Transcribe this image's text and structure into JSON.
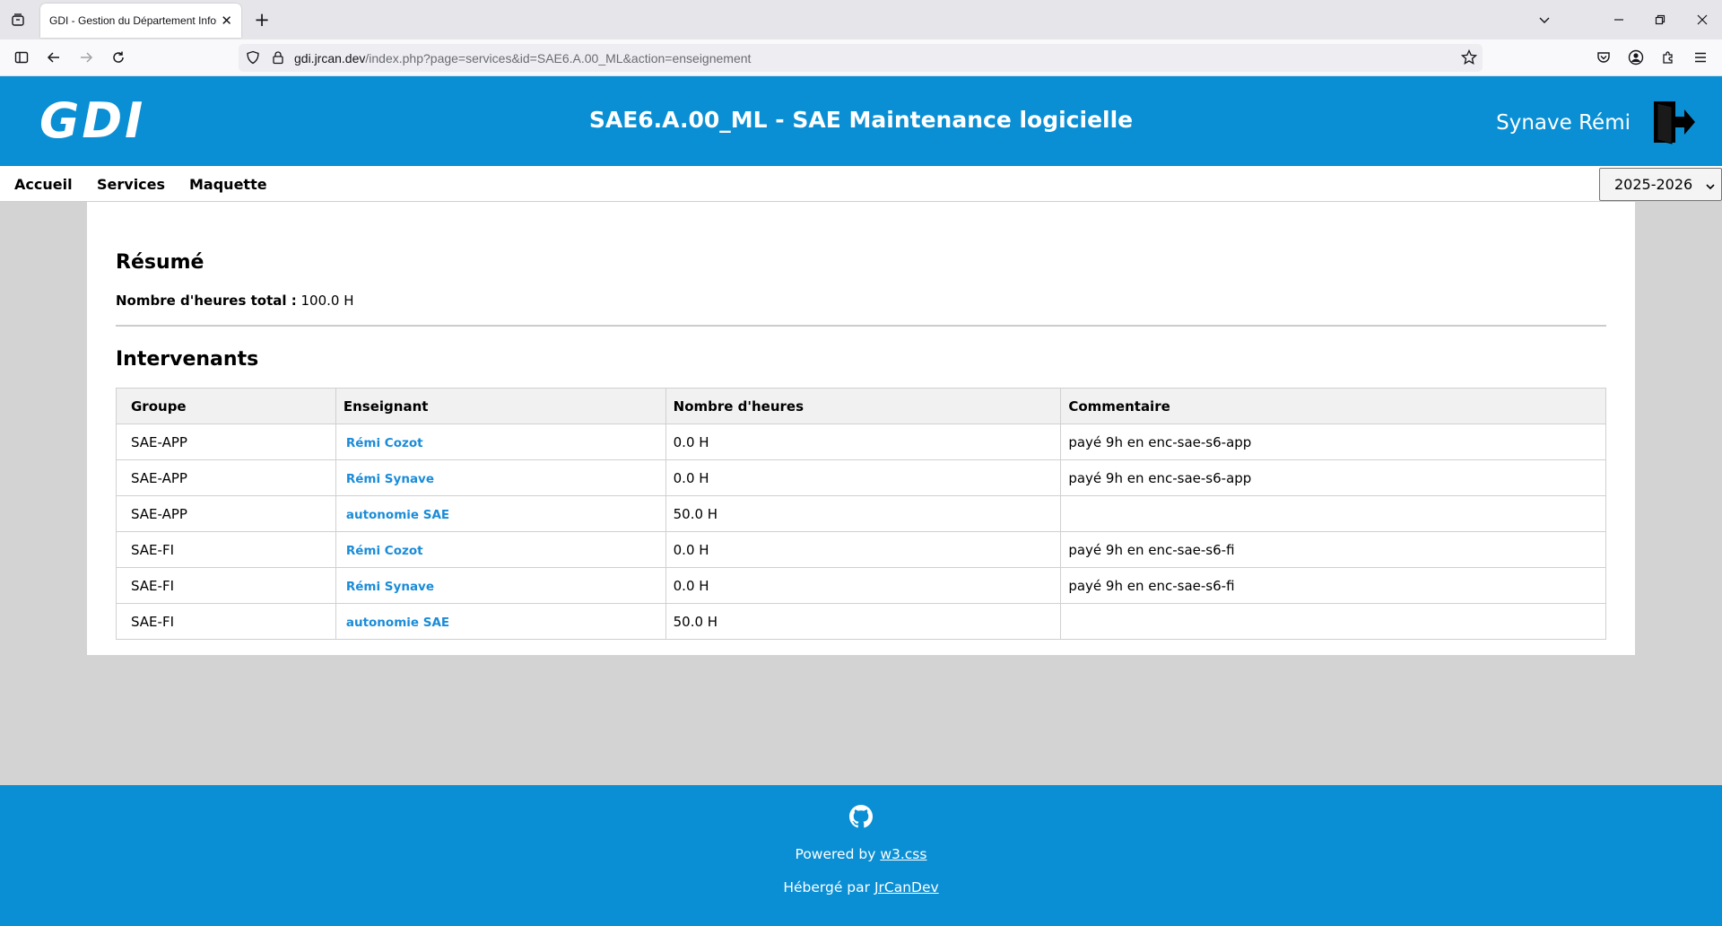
{
  "browser": {
    "tab_title": "GDI - Gestion du Département Informatique",
    "url_host": "gdi.jrcan.dev",
    "url_path": "/index.php?page=services&id=SAE6.A.00_ML&action=enseignement"
  },
  "header": {
    "logo": "GDI",
    "title": "SAE6.A.00_ML - SAE Maintenance logicielle",
    "user": "Synave Rémi"
  },
  "menu": {
    "items": [
      "Accueil",
      "Services",
      "Maquette"
    ],
    "year_selected": "2025-2026"
  },
  "summary": {
    "heading": "Résumé",
    "total_label": "Nombre d'heures total :",
    "total_value": "100.0 H"
  },
  "intervenants": {
    "heading": "Intervenants",
    "columns": [
      "Groupe",
      "Enseignant",
      "Nombre d'heures",
      "Commentaire"
    ],
    "rows": [
      {
        "groupe": "SAE-APP",
        "enseignant": "Rémi Cozot",
        "heures": "0.0 H",
        "commentaire": "payé 9h en enc-sae-s6-app"
      },
      {
        "groupe": "SAE-APP",
        "enseignant": "Rémi Synave",
        "heures": "0.0 H",
        "commentaire": "payé 9h en enc-sae-s6-app"
      },
      {
        "groupe": "SAE-APP",
        "enseignant": "autonomie SAE",
        "heures": "50.0 H",
        "commentaire": ""
      },
      {
        "groupe": "SAE-FI",
        "enseignant": "Rémi Cozot",
        "heures": "0.0 H",
        "commentaire": "payé 9h en enc-sae-s6-fi"
      },
      {
        "groupe": "SAE-FI",
        "enseignant": "Rémi Synave",
        "heures": "0.0 H",
        "commentaire": "payé 9h en enc-sae-s6-fi"
      },
      {
        "groupe": "SAE-FI",
        "enseignant": "autonomie SAE",
        "heures": "50.0 H",
        "commentaire": ""
      }
    ]
  },
  "footer": {
    "powered_prefix": "Powered by",
    "powered_link": "w3.css",
    "hosted_prefix": "Hébergé par",
    "hosted_link": "JrCanDev"
  },
  "colors": {
    "brand_blue": "#0a8fd4",
    "link_blue": "#1a8cd8",
    "page_bg": "#d3d3d3"
  },
  "icons": [
    "tab-list-icon",
    "new-tab-icon",
    "sidebar-icon",
    "back-icon",
    "forward-icon",
    "reload-icon",
    "shield-icon",
    "lock-icon",
    "bookmark-star-icon",
    "pocket-icon",
    "account-icon",
    "extensions-icon",
    "menu-icon",
    "logout-door-icon",
    "github-icon",
    "chevron-down-icon"
  ]
}
